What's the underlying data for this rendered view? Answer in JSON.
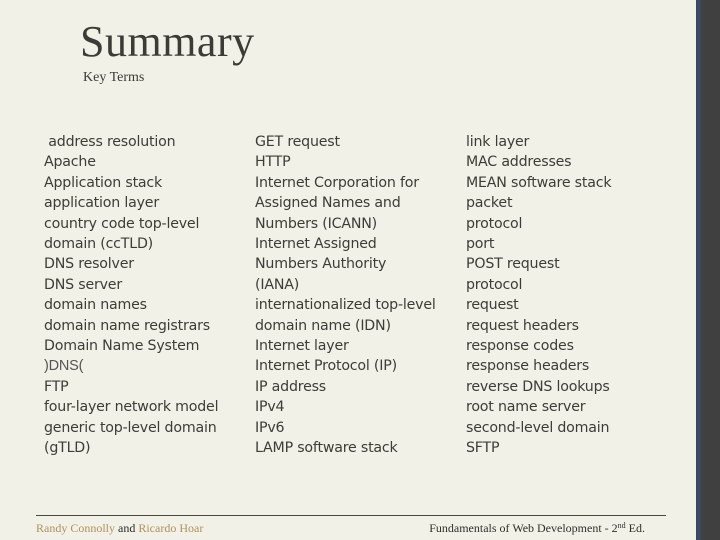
{
  "slide": {
    "title": "Summary",
    "subtitle": "Key Terms",
    "columns": [
      {
        "terms": [
          " address resolution",
          "Apache",
          "Application stack",
          "application layer",
          "country code top-level",
          "domain (ccTLD)",
          "DNS resolver",
          "DNS server",
          "domain names",
          "domain name registrars",
          "Domain Name System",
          ")DNS(",
          "FTP",
          "four-layer network model",
          "generic top-level domain",
          "(gTLD)"
        ]
      },
      {
        "terms": [
          "GET request",
          "HTTP",
          "Internet Corporation for",
          "Assigned Names and",
          "Numbers (ICANN)",
          "Internet Assigned",
          "Numbers Authority",
          "(IANA)",
          "internationalized top-level",
          "domain name (IDN)",
          "Internet layer",
          "Internet Protocol (IP)",
          "IP address",
          "IPv4",
          "IPv6",
          "LAMP software stack"
        ]
      },
      {
        "terms": [
          "link layer",
          "MAC addresses",
          "MEAN software stack",
          "packet",
          "protocol",
          "port",
          "POST request",
          "protocol",
          "request",
          "request headers",
          "response codes",
          "response headers",
          "reverse DNS lookups",
          "root name server",
          "second-level domain",
          "SFTP"
        ]
      }
    ]
  },
  "footer": {
    "author1": "Randy Connolly",
    "conjunction": " and ",
    "author2": "Ricardo Hoar",
    "book_title": "Fundamentals of Web Development - 2",
    "edition_sup": "nd",
    "edition_suffix": " Ed."
  },
  "colors": {
    "background": "#f2f1e7",
    "text": "#3c3c38",
    "author": "#b0915a",
    "side_accent": "#3a4d6a",
    "side_bar": "#404040"
  }
}
